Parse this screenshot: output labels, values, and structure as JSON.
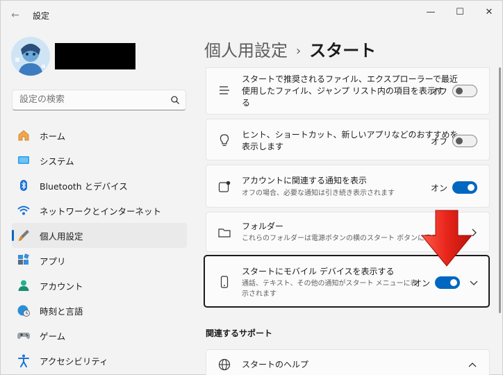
{
  "window": {
    "title": "設定",
    "back_glyph": "←",
    "minimize_glyph": "—",
    "maximize_glyph": "☐",
    "close_glyph": "✕"
  },
  "search": {
    "placeholder": "設定の検索"
  },
  "sidebar": {
    "items": [
      {
        "label": "ホーム",
        "icon": "home-icon"
      },
      {
        "label": "システム",
        "icon": "system-icon"
      },
      {
        "label": "Bluetooth とデバイス",
        "icon": "bluetooth-icon"
      },
      {
        "label": "ネットワークとインターネット",
        "icon": "wifi-icon"
      },
      {
        "label": "個人用設定",
        "icon": "brush-icon",
        "active": true
      },
      {
        "label": "アプリ",
        "icon": "apps-icon"
      },
      {
        "label": "アカウント",
        "icon": "account-icon"
      },
      {
        "label": "時刻と言語",
        "icon": "globe-clock-icon"
      },
      {
        "label": "ゲーム",
        "icon": "gamepad-icon"
      },
      {
        "label": "アクセシビリティ",
        "icon": "accessibility-icon"
      }
    ]
  },
  "breadcrumb": {
    "parent": "個人用設定",
    "separator": "›",
    "current": "スタート"
  },
  "settings": {
    "recommended_files": {
      "title_line1": "スタートで推奨されるファイル、エクスプローラーで最近",
      "title_line2": "使用したファイル、ジャンプ リスト内の項目を表示す",
      "title_line3": "る",
      "state": "オフ",
      "on": false
    },
    "tips": {
      "title_line1": "ヒント、ショートカット、新しいアプリなどのおすすめを",
      "title_line2": "表示します",
      "state": "オフ",
      "on": false
    },
    "account_notifications": {
      "title": "アカウントに関連する通知を表示",
      "subtitle": "オフの場合、必要な通知は引き続き表示されます",
      "state": "オン",
      "on": true
    },
    "folders": {
      "title": "フォルダー",
      "subtitle": "これらのフォルダーは電源ボタンの横のスタート ボタンに表示され"
    },
    "mobile_devices": {
      "title": "スタートにモバイル デバイスを表示する",
      "subtitle_line1": "通話、テキスト、その他の通知がスタート メニューに表",
      "subtitle_line2": "示されます",
      "state": "オン",
      "on": true
    }
  },
  "related": {
    "heading": "関連するサポート",
    "help_title": "スタートのヘルプ"
  },
  "colors": {
    "accent": "#0067c0",
    "annotation_arrow": "#e8251b"
  }
}
